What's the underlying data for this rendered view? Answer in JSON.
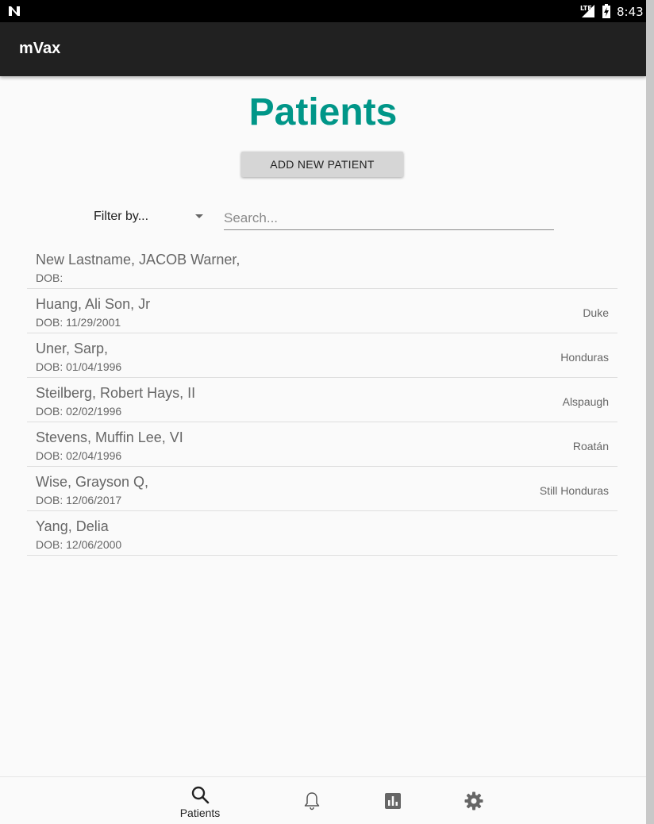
{
  "status_bar": {
    "network": "LTE",
    "time": "8:43"
  },
  "app_bar": {
    "title": "mVax"
  },
  "page": {
    "title": "Patients",
    "add_button_label": "ADD NEW PATIENT"
  },
  "filter": {
    "selected": "Filter by..."
  },
  "search": {
    "placeholder": "Search..."
  },
  "patients": [
    {
      "name": "New Lastname, JACOB Warner,",
      "dob": "DOB:",
      "location": ""
    },
    {
      "name": "Huang, Ali Son, Jr",
      "dob": "DOB: 11/29/2001",
      "location": "Duke"
    },
    {
      "name": "Uner, Sarp,",
      "dob": "DOB: 01/04/1996",
      "location": "Honduras"
    },
    {
      "name": "Steilberg, Robert Hays, II",
      "dob": "DOB: 02/02/1996",
      "location": "Alspaugh"
    },
    {
      "name": "Stevens, Muffin Lee, VI",
      "dob": "DOB: 02/04/1996",
      "location": "Roatán"
    },
    {
      "name": "Wise, Grayson Q,",
      "dob": "DOB: 12/06/2017",
      "location": "Still Honduras"
    },
    {
      "name": "Yang, Delia",
      "dob": "DOB: 12/06/2000",
      "location": ""
    }
  ],
  "bottom_nav": {
    "items": [
      {
        "icon": "search-icon",
        "label": "Patients"
      },
      {
        "icon": "bell-icon",
        "label": ""
      },
      {
        "icon": "chart-icon",
        "label": ""
      },
      {
        "icon": "gear-icon",
        "label": ""
      }
    ]
  },
  "colors": {
    "accent": "#009688",
    "app_bar": "#212121",
    "background": "#fafafa"
  }
}
